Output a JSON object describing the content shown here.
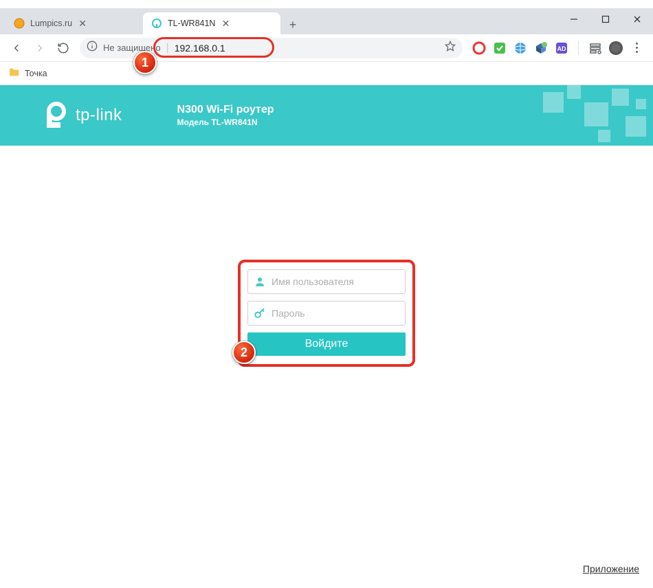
{
  "window": {
    "tabs": [
      {
        "title": "Lumpics.ru",
        "active": false
      },
      {
        "title": "TL-WR841N",
        "active": true
      }
    ]
  },
  "toolbar": {
    "security_label": "Не защищено",
    "url": "192.168.0.1"
  },
  "bookmarks": {
    "items": [
      {
        "label": "Точка"
      }
    ]
  },
  "banner": {
    "brand": "tp-link",
    "title": "N300 Wi-Fi роутер",
    "subtitle": "Модель TL-WR841N"
  },
  "login": {
    "username_placeholder": "Имя пользователя",
    "password_placeholder": "Пароль",
    "submit_label": "Войдите"
  },
  "footer": {
    "app_link_label": "Приложение"
  },
  "callouts": {
    "one": "1",
    "two": "2"
  }
}
